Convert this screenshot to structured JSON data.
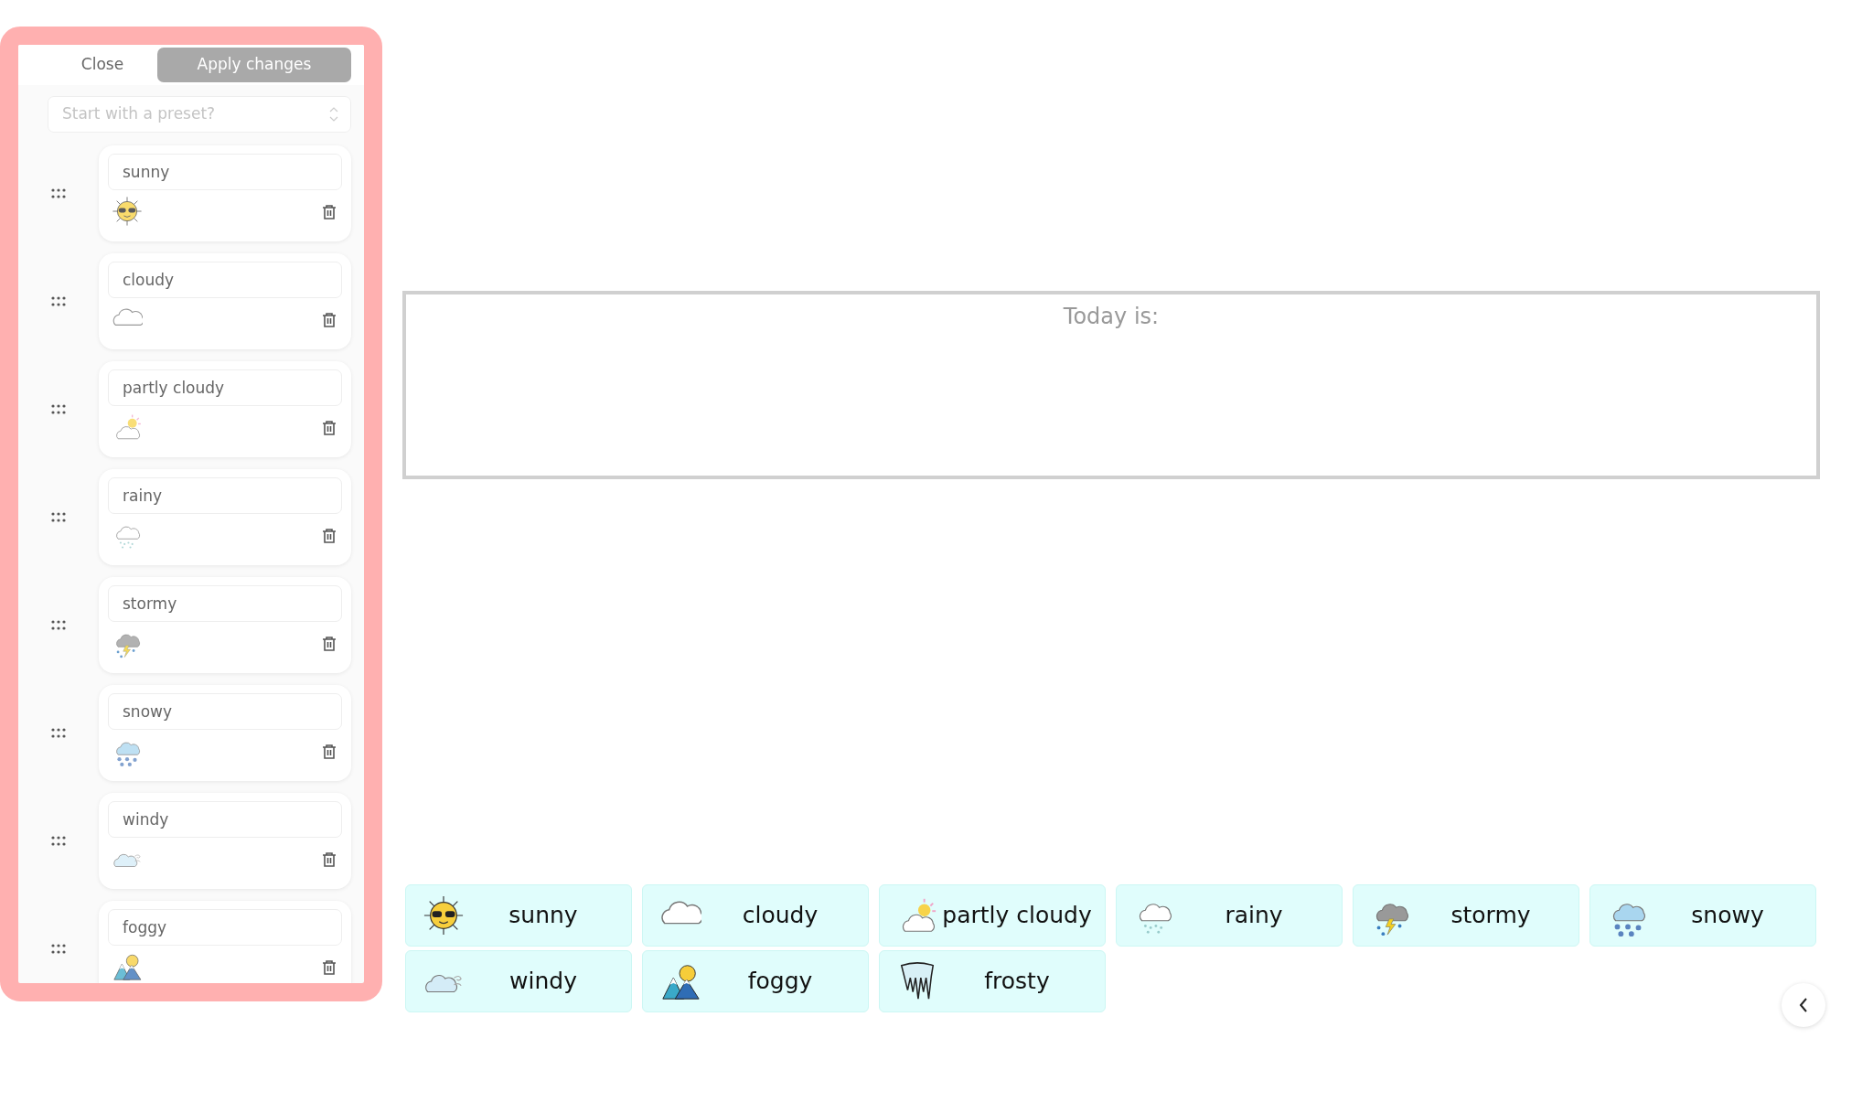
{
  "editor": {
    "close_button": "Close",
    "apply_button": "Apply changes",
    "apply_disabled": true,
    "preset_select": {
      "placeholder": "Start with a preset?"
    },
    "items": [
      {
        "label": "sunny",
        "kind": "sunny"
      },
      {
        "label": "cloudy",
        "kind": "cloudy"
      },
      {
        "label": "partly cloudy",
        "kind": "partly"
      },
      {
        "label": "rainy",
        "kind": "rainy"
      },
      {
        "label": "stormy",
        "kind": "stormy"
      },
      {
        "label": "snowy",
        "kind": "snowy"
      },
      {
        "label": "windy",
        "kind": "windy"
      },
      {
        "label": "foggy",
        "kind": "foggy"
      }
    ]
  },
  "board": {
    "title": "Today is:"
  },
  "tiles": [
    {
      "label": "sunny",
      "kind": "sunny"
    },
    {
      "label": "cloudy",
      "kind": "cloudy"
    },
    {
      "label": "partly cloudy",
      "kind": "partly"
    },
    {
      "label": "rainy",
      "kind": "rainy"
    },
    {
      "label": "stormy",
      "kind": "stormy"
    },
    {
      "label": "snowy",
      "kind": "snowy"
    },
    {
      "label": "windy",
      "kind": "windy"
    },
    {
      "label": "foggy",
      "kind": "foggy"
    },
    {
      "label": "frosty",
      "kind": "frosty"
    }
  ]
}
